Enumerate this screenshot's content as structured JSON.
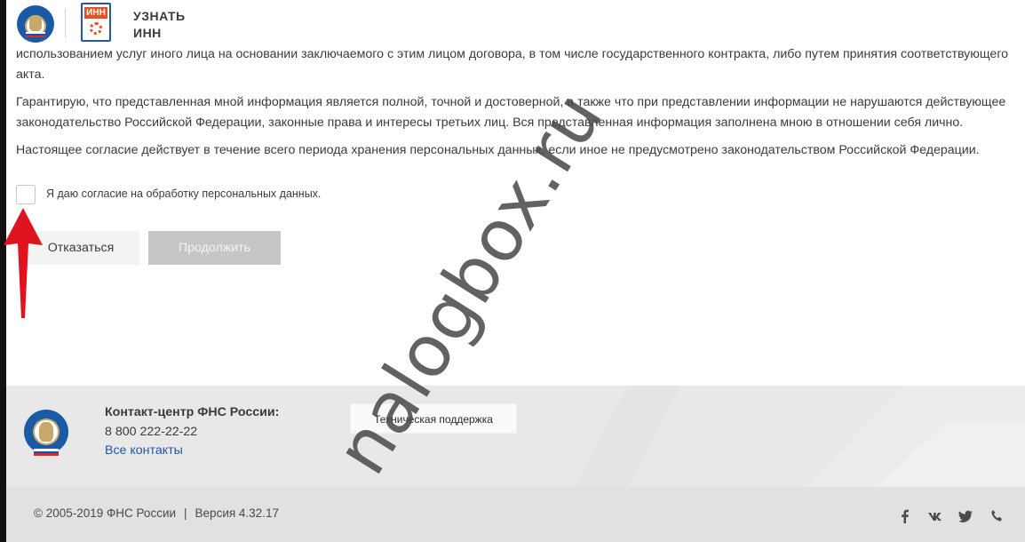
{
  "header": {
    "inn_badge": "ИНН",
    "service_title": "УЗНАТЬ ИНН"
  },
  "content": {
    "paragraphs": [
      "использованием услуг иного лица на основании заключаемого с этим лицом договора, в том числе государственного контракта, либо путем принятия соответствующего акта.",
      "Гарантирую, что представленная мной информация является полной, точной и достоверной, а также что при представлении информации не нарушаются действующее законодательство Российской Федерации, законные права и интересы третьих лиц. Вся представленная информация заполнена мною в отношении себя лично.",
      "Настоящее согласие действует в течение всего периода хранения персональных данных, если иное не предусмотрено законодательством Российской Федерации."
    ],
    "consent_label": "Я даю согласие на обработку персональных данных.",
    "consent_checked": false
  },
  "actions": {
    "decline_label": "Отказаться",
    "continue_label": "Продолжить"
  },
  "footer": {
    "contact_title": "Контакт-центр ФНС России:",
    "contact_phone": "8 800 222-22-22",
    "contact_link": "Все контакты",
    "support_button": "Техническая поддержка",
    "copyright": "© 2005-2019 ФНС России",
    "separator": "|",
    "version": "Версия 4.32.17",
    "social_icons": [
      "facebook-icon",
      "vk-icon",
      "twitter-icon",
      "phone-icon"
    ]
  },
  "watermark": "nalogbox.ru",
  "colors": {
    "accent_blue": "#1f5aa6",
    "inn_orange": "#e8501e",
    "arrow_red": "#e0141e",
    "footer_bg": "#e8e8e8"
  }
}
